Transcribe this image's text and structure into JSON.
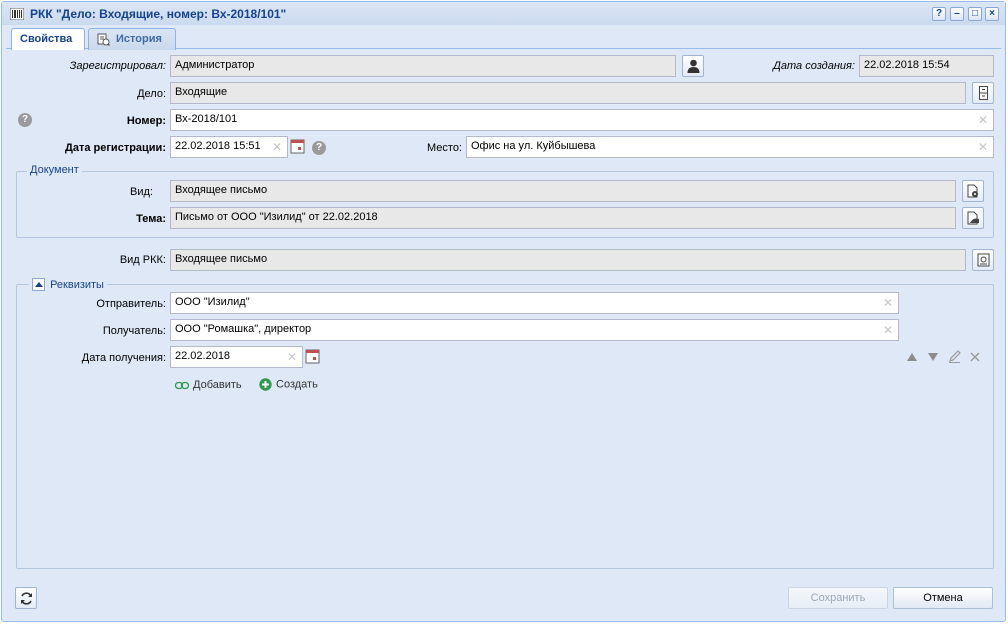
{
  "window": {
    "title": "РКК \"Дело: Входящие, номер: Вх-2018/101\"",
    "controls": [
      "?",
      "–",
      "□",
      "×"
    ]
  },
  "tabs": [
    {
      "label": "Свойства",
      "active": true
    },
    {
      "label": "История",
      "active": false
    }
  ],
  "form": {
    "registered_by": {
      "label": "Зарегистрировал:",
      "value": "Администратор"
    },
    "created": {
      "label": "Дата создания:",
      "value": "22.02.2018 15:54"
    },
    "case": {
      "label": "Дело:",
      "value": "Входящие"
    },
    "number": {
      "label": "Номер:",
      "value": "Вх-2018/101"
    },
    "reg_date": {
      "label": "Дата регистрации:",
      "value": "22.02.2018 15:51"
    },
    "place": {
      "label": "Место:",
      "value": "Офис на ул. Куйбышева"
    }
  },
  "document": {
    "legend": "Документ",
    "kind": {
      "label": "Вид:",
      "value": "Входящее письмо"
    },
    "subject": {
      "label": "Тема:",
      "value": "Письмо от ООО \"Изилид\" от 22.02.2018"
    }
  },
  "rkk_kind": {
    "label": "Вид РКК:",
    "value": "Входящее письмо"
  },
  "requisites": {
    "legend": "Реквизиты",
    "sender": {
      "label": "Отправитель:",
      "value": "ООО \"Изилид\""
    },
    "recipient": {
      "label": "Получатель:",
      "value": "ООО \"Ромашка\", директор"
    },
    "received": {
      "label": "Дата получения:",
      "value": "22.02.2018"
    },
    "add_label": "Добавить",
    "create_label": "Создать"
  },
  "footer": {
    "save_label": "Сохранить",
    "cancel_label": "Отмена"
  },
  "colors": {
    "panel": "#dfe8f6",
    "title": "#15428b",
    "accent_green": "#2e9a4c"
  }
}
